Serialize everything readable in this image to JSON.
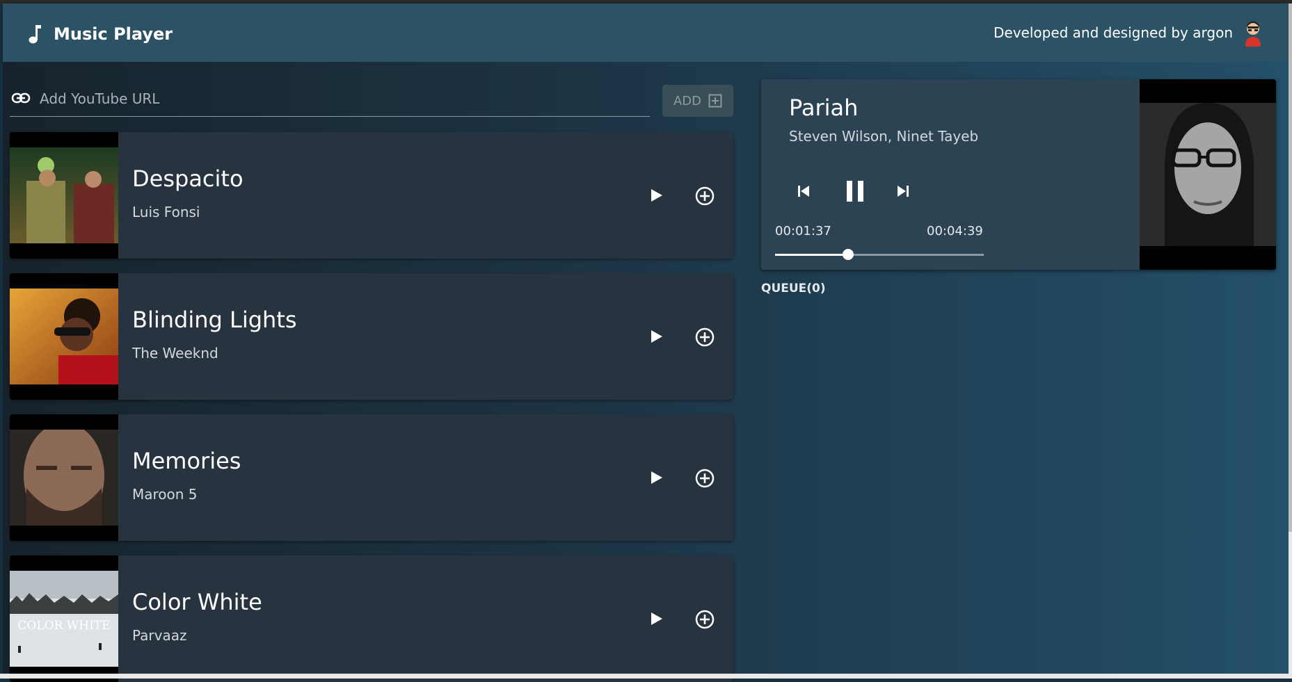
{
  "header": {
    "title": "Music Player",
    "credit": "Developed and designed by argon"
  },
  "url_input": {
    "placeholder": "Add YouTube URL",
    "value": ""
  },
  "add_button": {
    "label": "ADD"
  },
  "songs": [
    {
      "title": "Despacito",
      "artist": "Luis Fonsi"
    },
    {
      "title": "Blinding Lights",
      "artist": "The Weeknd"
    },
    {
      "title": "Memories",
      "artist": "Maroon 5"
    },
    {
      "title": "Color White",
      "artist": "Parvaaz",
      "thumb_text": "COLOR WHITE"
    }
  ],
  "now_playing": {
    "title": "Pariah",
    "artist": "Steven Wilson, Ninet Tayeb",
    "elapsed": "00:01:37",
    "duration": "00:04:39",
    "progress_fraction": 0.35
  },
  "queue": {
    "label": "QUEUE(0)"
  },
  "colors": {
    "appbar": "#2c5266",
    "card": "#27333e",
    "player": "#2c4354",
    "page": "#173141"
  },
  "icons": {
    "logo": "music-note-icon",
    "url": "link-icon",
    "add": "add-box-icon",
    "play": "play-icon",
    "queue_add": "add-circle-icon",
    "prev": "skip-previous-icon",
    "pause": "pause-icon",
    "next": "skip-next-icon"
  }
}
